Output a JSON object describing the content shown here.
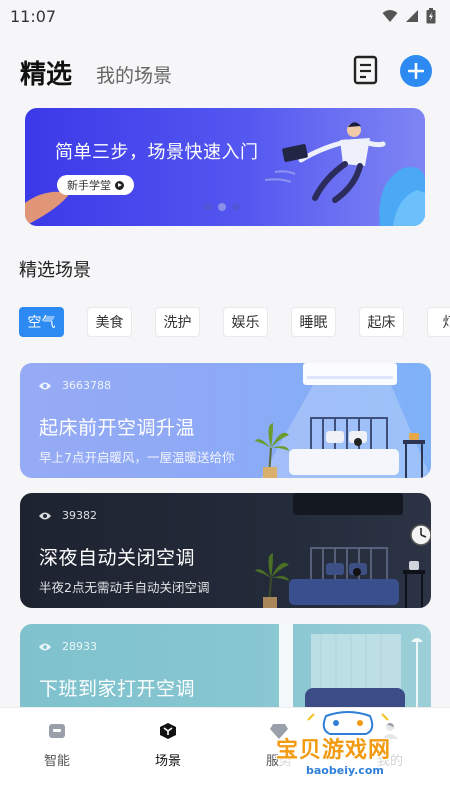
{
  "status_bar": {
    "time": "11:07"
  },
  "header": {
    "selected_tab": "精选",
    "other_tab": "我的场景"
  },
  "banner": {
    "title": "简单三步，场景快速入门",
    "button_label": "新手学堂",
    "dots": 3,
    "active_dot": 1
  },
  "section": {
    "title": "精选场景"
  },
  "chips": [
    {
      "label": "空气",
      "active": true
    },
    {
      "label": "美食",
      "active": false
    },
    {
      "label": "洗护",
      "active": false
    },
    {
      "label": "娱乐",
      "active": false
    },
    {
      "label": "睡眠",
      "active": false
    },
    {
      "label": "起床",
      "active": false
    },
    {
      "label": "灯",
      "active": false
    }
  ],
  "cards": [
    {
      "views": "3663788",
      "title": "起床前开空调升温",
      "subtitle": "早上7点开启暖风，一屋温暖送给你"
    },
    {
      "views": "39382",
      "title": "深夜自动关闭空调",
      "subtitle": "半夜2点无需动手自动关闭空调"
    },
    {
      "views": "28933",
      "title": "下班到家打开空调",
      "subtitle": ""
    }
  ],
  "tabbar": [
    {
      "label": "智能",
      "icon": "home-device-icon",
      "active": false
    },
    {
      "label": "场景",
      "icon": "scene-cube-icon",
      "active": true
    },
    {
      "label": "服务",
      "icon": "diamond-icon",
      "active": false
    },
    {
      "label": "我的",
      "icon": "person-icon",
      "active": false
    }
  ],
  "watermark": {
    "text": "宝贝游戏网",
    "url": "baobeiy.com"
  },
  "colors": {
    "accent": "#2c8af2",
    "banner": "#4a4cee",
    "card_blue": "#8ea9f6",
    "card_dark": "#232a39",
    "card_teal": "#86c6d1"
  }
}
